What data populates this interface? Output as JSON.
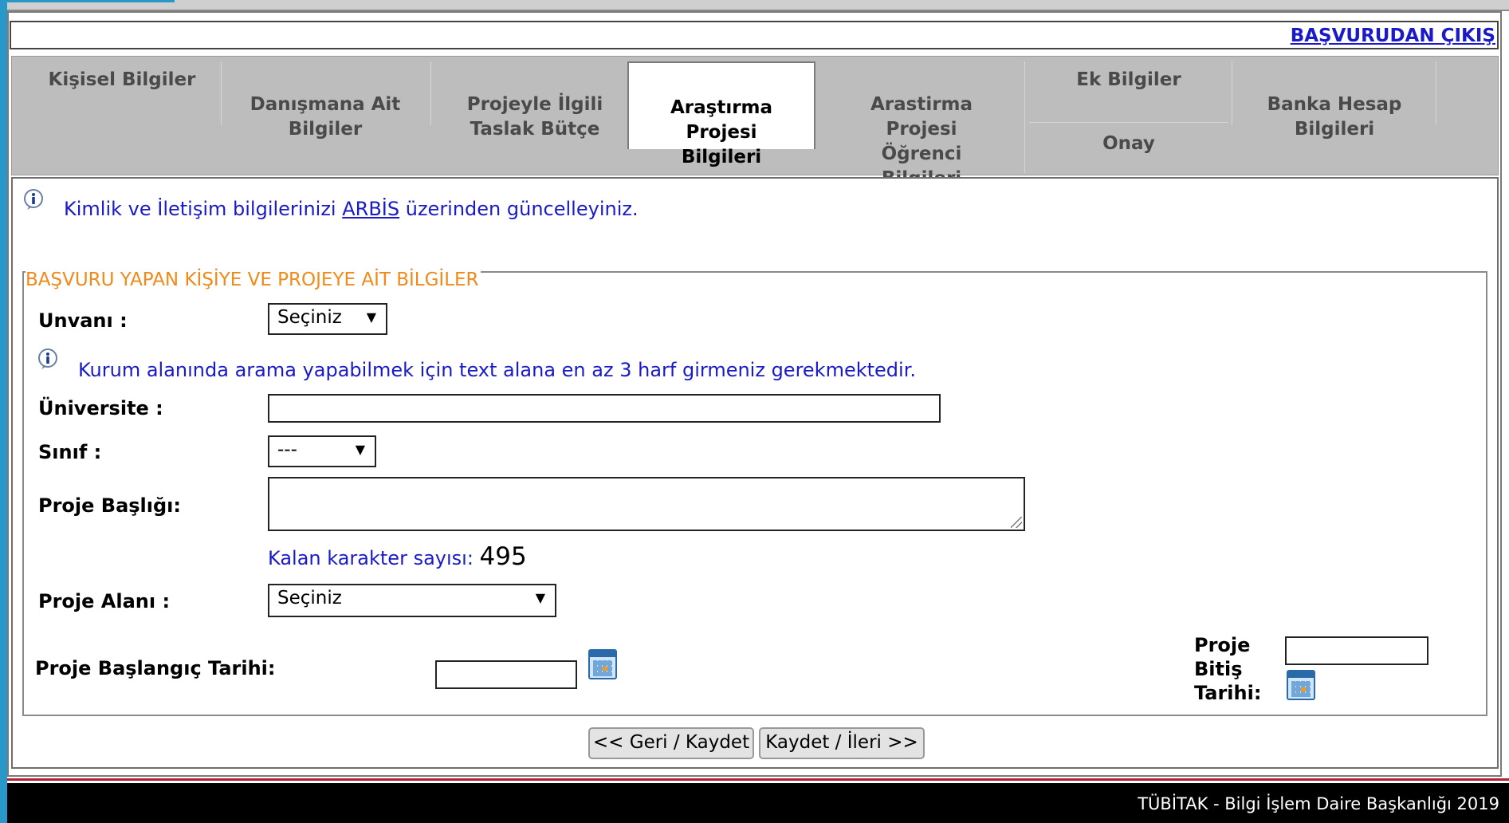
{
  "header": {
    "exit_label": "BAŞVURUDAN ÇIKIŞ"
  },
  "tabs": {
    "kisisel": "Kişisel Bilgiler",
    "danisman": "Danışmana Ait\nBilgiler",
    "butce": "Projeyle İlgili\nTaslak Bütçe",
    "arastirma": "Araştırma\nProjesi\nBilgileri",
    "ogrenci": "Arastirma\nProjesi\nÖğrenci\nBilgileri",
    "ek": "Ek Bilgiler",
    "banka": "Banka Hesap\nBilgileri",
    "onay": "Onay"
  },
  "info1": {
    "before": "Kimlik ve İletişim bilgilerinizi ",
    "link": "ARBİS",
    "after": " üzerinden güncelleyiniz."
  },
  "group": {
    "legend": "BAŞVURU YAPAN KİŞİYE VE PROJEYE AİT BİLGİLER"
  },
  "info2": {
    "text": "Kurum alanında arama yapabilmek için text alana en az 3 harf girmeniz gerekmektedir."
  },
  "form": {
    "unvan_label": "Unvanı :",
    "unvan_value": "Seçiniz",
    "universite_label": "Üniversite :",
    "universite_value": "",
    "sinif_label": "Sınıf :",
    "sinif_value": "---",
    "baslik_label": "Proje Başlığı:",
    "baslik_value": "",
    "counter_label": "Kalan karakter sayısı",
    "counter_value": "495",
    "alan_label": "Proje Alanı :",
    "alan_value": "Seçiniz",
    "baslangic_label": "Proje Başlangıç Tarihi:",
    "baslangic_value": "",
    "bitis_label": "Proje\nBitiş\nTarihi:",
    "bitis_value": ""
  },
  "buttons": {
    "back": "<< Geri / Kaydet",
    "next": "Kaydet / İleri >>"
  },
  "footer": {
    "text": "TÜBİTAK - Bilgi İşlem Daire Başkanlığı 2019"
  },
  "colors": {
    "accent_blue": "#2a97c9",
    "link_blue": "#1a1ac9",
    "legend_orange": "#f08a1a",
    "footer_red": "#b51f2f"
  }
}
